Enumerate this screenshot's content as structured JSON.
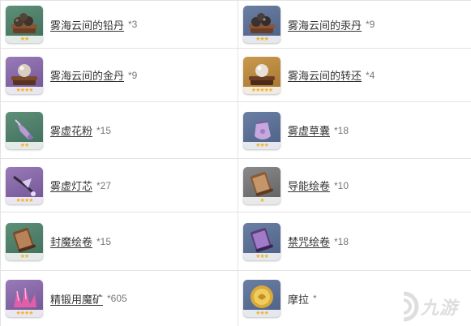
{
  "items": [
    {
      "name": "雾海云间的铅丹",
      "count": "*3",
      "icon": "lead-pellets-icon",
      "stars": "★★"
    },
    {
      "name": "雾海云间的汞丹",
      "count": "*9",
      "icon": "mercury-pellets-icon",
      "stars": "★★★"
    },
    {
      "name": "雾海云间的金丹",
      "count": "*9",
      "icon": "golden-pellet-icon",
      "stars": "★★★★"
    },
    {
      "name": "雾海云间的转还",
      "count": "*4",
      "icon": "golden-pellet-rebirth-icon",
      "stars": "★★★★★"
    },
    {
      "name": "雾虚花粉",
      "count": "*15",
      "icon": "mist-pollen-icon",
      "stars": "★★"
    },
    {
      "name": "雾虚草囊",
      "count": "*18",
      "icon": "mist-grass-pouch-icon",
      "stars": "★★★"
    },
    {
      "name": "雾虚灯芯",
      "count": "*27",
      "icon": "mist-lamp-wick-icon",
      "stars": "★★★★"
    },
    {
      "name": "导能绘卷",
      "count": "*10",
      "icon": "conductive-scroll-icon",
      "stars": "★"
    },
    {
      "name": "封魔绘卷",
      "count": "*15",
      "icon": "sealing-scroll-icon",
      "stars": "★★"
    },
    {
      "name": "禁咒绘卷",
      "count": "*18",
      "icon": "forbidden-curse-scroll-icon",
      "stars": "★★★"
    },
    {
      "name": "精锻用魔矿",
      "count": "*605",
      "icon": "mystic-enhancement-ore-icon",
      "stars": "★★★★"
    },
    {
      "name": "摩拉",
      "count": "*",
      "icon": "mora-coin-icon",
      "stars": "★★★"
    }
  ],
  "watermark": {
    "text": "九游",
    "icon": "jiuyou-logo-icon"
  }
}
